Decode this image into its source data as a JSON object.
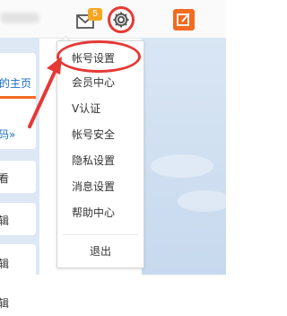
{
  "colors": {
    "accent": "#f26b21",
    "badge": "#f5a623",
    "link": "#1a6fc4",
    "annotation": "#e53935"
  },
  "topbar": {
    "mail_icon": "envelope-icon",
    "mail_badge": "5",
    "settings_icon": "gear-icon",
    "compose_icon": "pencil-square-icon"
  },
  "left_partial": {
    "home_link": "的主页",
    "item2": "码»",
    "item3": "看",
    "item4": "辑",
    "item5": "辑",
    "item6": "辑"
  },
  "settings_menu": {
    "items": [
      {
        "label": "帐号设置"
      },
      {
        "label": "会员中心"
      },
      {
        "label": "V认证"
      },
      {
        "label": "帐号安全"
      },
      {
        "label": "隐私设置"
      },
      {
        "label": "消息设置"
      },
      {
        "label": "帮助中心"
      }
    ],
    "logout": "退出"
  }
}
